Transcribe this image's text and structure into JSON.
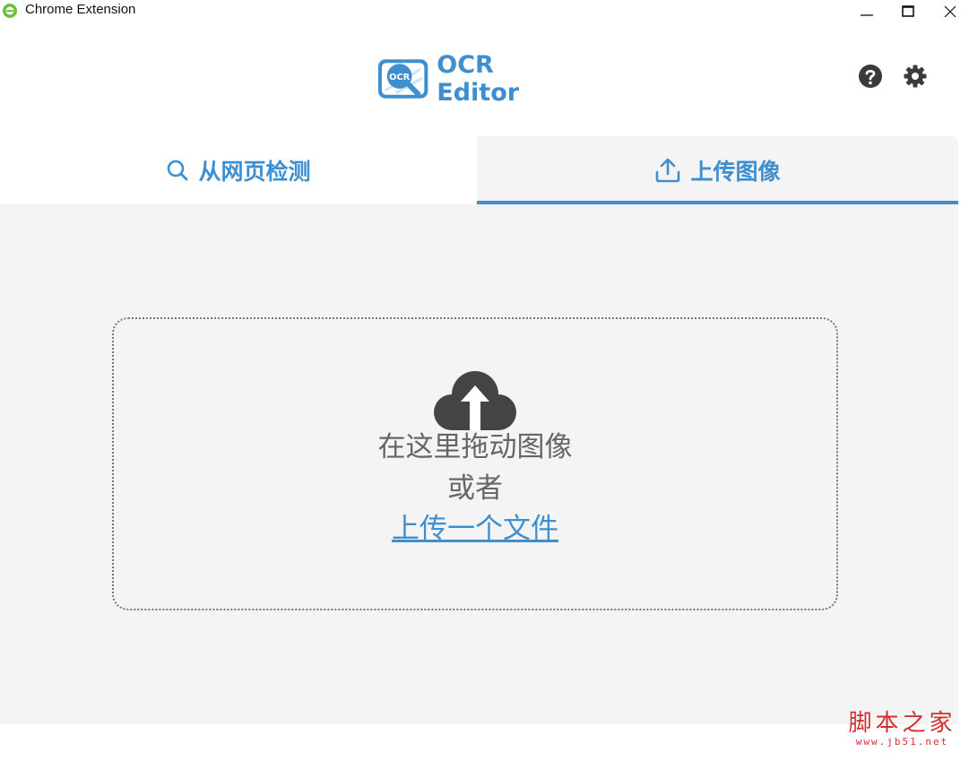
{
  "window": {
    "title": "Chrome Extension",
    "icon": "chrome-ie-icon",
    "controls": [
      "minimize-icon",
      "maximize-icon",
      "close-icon"
    ]
  },
  "header": {
    "logo_badge": "OCR",
    "logo_text": "OCR Editor",
    "help_icon": "question-circle-icon",
    "settings_icon": "gear-icon"
  },
  "tabs": [
    {
      "label": "从网页检测",
      "icon": "search-icon",
      "active": false
    },
    {
      "label": "上传图像",
      "icon": "upload-icon",
      "active": true
    }
  ],
  "dropzone": {
    "icon": "cloud-upload-icon",
    "line1": "在这里拖动图像",
    "line2": "或者",
    "link": "上传一个文件"
  },
  "watermark": {
    "main": "脚本之家",
    "sub": "www.jb51.net"
  },
  "colors": {
    "accent": "#3d8fd0",
    "content_bg": "#f4f4f4",
    "text_gray": "#666666",
    "icon_dark": "#444444",
    "watermark": "#d23030"
  }
}
